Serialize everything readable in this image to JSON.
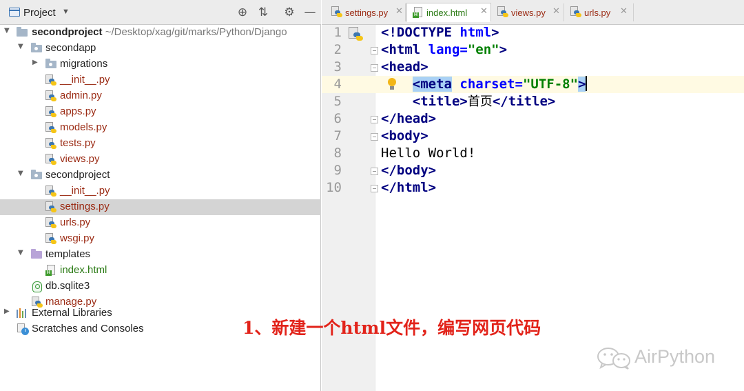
{
  "project_panel": {
    "title": "Project",
    "tree": [
      {
        "label": "secondproject",
        "path": "~/Desktop/xag/git/marks/Python/Django",
        "kind": "root"
      },
      {
        "label": "secondapp",
        "kind": "folder"
      },
      {
        "label": "migrations",
        "kind": "folder"
      },
      {
        "label": "__init__.py",
        "kind": "py"
      },
      {
        "label": "admin.py",
        "kind": "py"
      },
      {
        "label": "apps.py",
        "kind": "py"
      },
      {
        "label": "models.py",
        "kind": "py"
      },
      {
        "label": "tests.py",
        "kind": "py"
      },
      {
        "label": "views.py",
        "kind": "py"
      },
      {
        "label": "secondproject",
        "kind": "folder"
      },
      {
        "label": "__init__.py",
        "kind": "py"
      },
      {
        "label": "settings.py",
        "kind": "py",
        "selected": true
      },
      {
        "label": "urls.py",
        "kind": "py"
      },
      {
        "label": "wsgi.py",
        "kind": "py"
      },
      {
        "label": "templates",
        "kind": "folder"
      },
      {
        "label": "index.html",
        "kind": "html"
      },
      {
        "label": "db.sqlite3",
        "kind": "db"
      },
      {
        "label": "manage.py",
        "kind": "py"
      },
      {
        "label": "External Libraries",
        "kind": "libraries"
      },
      {
        "label": "Scratches and Consoles",
        "kind": "scratches"
      }
    ]
  },
  "tabs": [
    {
      "label": "settings.py",
      "kind": "py",
      "active": false
    },
    {
      "label": "index.html",
      "kind": "html",
      "active": true
    },
    {
      "label": "views.py",
      "kind": "py",
      "active": false
    },
    {
      "label": "urls.py",
      "kind": "py",
      "active": false
    }
  ],
  "editor": {
    "line_numbers": [
      "1",
      "2",
      "3",
      "4",
      "5",
      "6",
      "7",
      "8",
      "9",
      "10"
    ],
    "current_line": 4,
    "tokens": {
      "l1_doctype": "<!DOCTYPE ",
      "l1_html": "html",
      "l1_close": ">",
      "l2_open": "<html ",
      "l2_attr": "lang",
      "l2_eq": "=",
      "l2_val": "\"en\"",
      "l2_close": ">",
      "l3": "<head>",
      "l4_indent": "    ",
      "l4_open": "<meta",
      "l4_space": " ",
      "l4_attr": "charset",
      "l4_eq": "=",
      "l4_val": "\"UTF-8\"",
      "l4_close": ">",
      "l5_indent": "    ",
      "l5_open": "<title>",
      "l5_text": "首页",
      "l5_close": "</title>",
      "l6": "</head>",
      "l7": "<body>",
      "l8": "Hello World!",
      "l9": "</body>",
      "l10": "</html>"
    }
  },
  "annotation": {
    "text": "1、新建一个html文件，编写网页代码"
  },
  "watermark": {
    "text": "AirPython"
  }
}
